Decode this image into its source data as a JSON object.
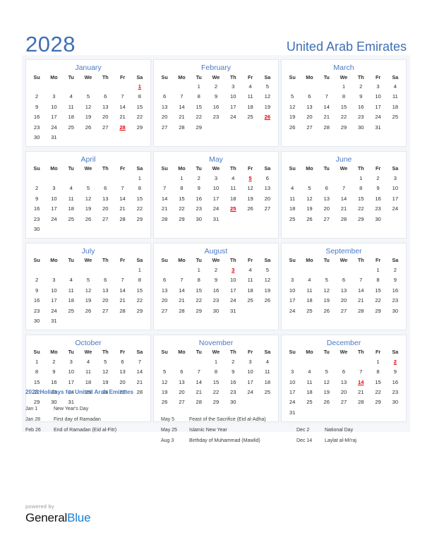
{
  "header": {
    "year": "2028",
    "country": "United Arab Emirates",
    "accent_color": "#3f6fb5"
  },
  "colors": {
    "month_name": "#4a79c4",
    "holiday_red": "#e4000c",
    "page_bg": "#ffffff",
    "grid_bg": "#f4f6f9"
  },
  "weekday_headers": [
    "Su",
    "Mo",
    "Tu",
    "We",
    "Th",
    "Fr",
    "Sa"
  ],
  "months": [
    {
      "name": "January",
      "weeks": [
        [
          "",
          "",
          "",
          "",
          "",
          "",
          "1"
        ],
        [
          "2",
          "3",
          "4",
          "5",
          "6",
          "7",
          "8"
        ],
        [
          "9",
          "10",
          "11",
          "12",
          "13",
          "14",
          "15"
        ],
        [
          "16",
          "17",
          "18",
          "19",
          "20",
          "21",
          "22"
        ],
        [
          "23",
          "24",
          "25",
          "26",
          "27",
          "28",
          "29"
        ],
        [
          "30",
          "31",
          "",
          "",
          "",
          "",
          ""
        ]
      ],
      "holidays": [
        "1",
        "28"
      ]
    },
    {
      "name": "February",
      "weeks": [
        [
          "",
          "",
          "1",
          "2",
          "3",
          "4",
          "5"
        ],
        [
          "6",
          "7",
          "8",
          "9",
          "10",
          "11",
          "12"
        ],
        [
          "13",
          "14",
          "15",
          "16",
          "17",
          "18",
          "19"
        ],
        [
          "20",
          "21",
          "22",
          "23",
          "24",
          "25",
          "26"
        ],
        [
          "27",
          "28",
          "29",
          "",
          "",
          "",
          ""
        ],
        [
          "",
          "",
          "",
          "",
          "",
          "",
          ""
        ]
      ],
      "holidays": [
        "26"
      ]
    },
    {
      "name": "March",
      "weeks": [
        [
          "",
          "",
          "",
          "1",
          "2",
          "3",
          "4"
        ],
        [
          "5",
          "6",
          "7",
          "8",
          "9",
          "10",
          "11"
        ],
        [
          "12",
          "13",
          "14",
          "15",
          "16",
          "17",
          "18"
        ],
        [
          "19",
          "20",
          "21",
          "22",
          "23",
          "24",
          "25"
        ],
        [
          "26",
          "27",
          "28",
          "29",
          "30",
          "31",
          ""
        ],
        [
          "",
          "",
          "",
          "",
          "",
          "",
          ""
        ]
      ],
      "holidays": []
    },
    {
      "name": "April",
      "weeks": [
        [
          "",
          "",
          "",
          "",
          "",
          "",
          "1"
        ],
        [
          "2",
          "3",
          "4",
          "5",
          "6",
          "7",
          "8"
        ],
        [
          "9",
          "10",
          "11",
          "12",
          "13",
          "14",
          "15"
        ],
        [
          "16",
          "17",
          "18",
          "19",
          "20",
          "21",
          "22"
        ],
        [
          "23",
          "24",
          "25",
          "26",
          "27",
          "28",
          "29"
        ],
        [
          "30",
          "",
          "",
          "",
          "",
          "",
          ""
        ]
      ],
      "holidays": []
    },
    {
      "name": "May",
      "weeks": [
        [
          "",
          "1",
          "2",
          "3",
          "4",
          "5",
          "6"
        ],
        [
          "7",
          "8",
          "9",
          "10",
          "11",
          "12",
          "13"
        ],
        [
          "14",
          "15",
          "16",
          "17",
          "18",
          "19",
          "20"
        ],
        [
          "21",
          "22",
          "23",
          "24",
          "25",
          "26",
          "27"
        ],
        [
          "28",
          "29",
          "30",
          "31",
          "",
          "",
          ""
        ],
        [
          "",
          "",
          "",
          "",
          "",
          "",
          ""
        ]
      ],
      "holidays": [
        "5",
        "25"
      ]
    },
    {
      "name": "June",
      "weeks": [
        [
          "",
          "",
          "",
          "",
          "1",
          "2",
          "3"
        ],
        [
          "4",
          "5",
          "6",
          "7",
          "8",
          "9",
          "10"
        ],
        [
          "11",
          "12",
          "13",
          "14",
          "15",
          "16",
          "17"
        ],
        [
          "18",
          "19",
          "20",
          "21",
          "22",
          "23",
          "24"
        ],
        [
          "25",
          "26",
          "27",
          "28",
          "29",
          "30",
          ""
        ],
        [
          "",
          "",
          "",
          "",
          "",
          "",
          ""
        ]
      ],
      "holidays": []
    },
    {
      "name": "July",
      "weeks": [
        [
          "",
          "",
          "",
          "",
          "",
          "",
          "1"
        ],
        [
          "2",
          "3",
          "4",
          "5",
          "6",
          "7",
          "8"
        ],
        [
          "9",
          "10",
          "11",
          "12",
          "13",
          "14",
          "15"
        ],
        [
          "16",
          "17",
          "18",
          "19",
          "20",
          "21",
          "22"
        ],
        [
          "23",
          "24",
          "25",
          "26",
          "27",
          "28",
          "29"
        ],
        [
          "30",
          "31",
          "",
          "",
          "",
          "",
          ""
        ]
      ],
      "holidays": []
    },
    {
      "name": "August",
      "weeks": [
        [
          "",
          "",
          "1",
          "2",
          "3",
          "4",
          "5"
        ],
        [
          "6",
          "7",
          "8",
          "9",
          "10",
          "11",
          "12"
        ],
        [
          "13",
          "14",
          "15",
          "16",
          "17",
          "18",
          "19"
        ],
        [
          "20",
          "21",
          "22",
          "23",
          "24",
          "25",
          "26"
        ],
        [
          "27",
          "28",
          "29",
          "30",
          "31",
          "",
          ""
        ],
        [
          "",
          "",
          "",
          "",
          "",
          "",
          ""
        ]
      ],
      "holidays": [
        "3"
      ]
    },
    {
      "name": "September",
      "weeks": [
        [
          "",
          "",
          "",
          "",
          "",
          "1",
          "2"
        ],
        [
          "3",
          "4",
          "5",
          "6",
          "7",
          "8",
          "9"
        ],
        [
          "10",
          "11",
          "12",
          "13",
          "14",
          "15",
          "16"
        ],
        [
          "17",
          "18",
          "19",
          "20",
          "21",
          "22",
          "23"
        ],
        [
          "24",
          "25",
          "26",
          "27",
          "28",
          "29",
          "30"
        ],
        [
          "",
          "",
          "",
          "",
          "",
          "",
          ""
        ]
      ],
      "holidays": []
    },
    {
      "name": "October",
      "weeks": [
        [
          "1",
          "2",
          "3",
          "4",
          "5",
          "6",
          "7"
        ],
        [
          "8",
          "9",
          "10",
          "11",
          "12",
          "13",
          "14"
        ],
        [
          "15",
          "16",
          "17",
          "18",
          "19",
          "20",
          "21"
        ],
        [
          "22",
          "23",
          "24",
          "25",
          "26",
          "27",
          "28"
        ],
        [
          "29",
          "30",
          "31",
          "",
          "",
          "",
          ""
        ],
        [
          "",
          "",
          "",
          "",
          "",
          "",
          ""
        ]
      ],
      "holidays": []
    },
    {
      "name": "November",
      "weeks": [
        [
          "",
          "",
          "",
          "1",
          "2",
          "3",
          "4"
        ],
        [
          "5",
          "6",
          "7",
          "8",
          "9",
          "10",
          "11"
        ],
        [
          "12",
          "13",
          "14",
          "15",
          "16",
          "17",
          "18"
        ],
        [
          "19",
          "20",
          "21",
          "22",
          "23",
          "24",
          "25"
        ],
        [
          "26",
          "27",
          "28",
          "29",
          "30",
          "",
          ""
        ],
        [
          "",
          "",
          "",
          "",
          "",
          "",
          ""
        ]
      ],
      "holidays": []
    },
    {
      "name": "December",
      "weeks": [
        [
          "",
          "",
          "",
          "",
          "",
          "1",
          "2"
        ],
        [
          "3",
          "4",
          "5",
          "6",
          "7",
          "8",
          "9"
        ],
        [
          "10",
          "11",
          "12",
          "13",
          "14",
          "15",
          "16"
        ],
        [
          "17",
          "18",
          "19",
          "20",
          "21",
          "22",
          "23"
        ],
        [
          "24",
          "25",
          "26",
          "27",
          "28",
          "29",
          "30"
        ],
        [
          "31",
          "",
          "",
          "",
          "",
          "",
          ""
        ]
      ],
      "holidays": [
        "2",
        "14"
      ]
    }
  ],
  "holidays_section": {
    "title": "2028 Holidays for United Arab Emirates",
    "columns": [
      [
        {
          "date": "Jan 1",
          "name": "New Year's Day"
        },
        {
          "date": "Jan 28",
          "name": "First day of Ramadan"
        },
        {
          "date": "Feb 26",
          "name": "End of Ramadan (Eid al-Fitr)"
        }
      ],
      [
        {
          "date": "",
          "name": ""
        },
        {
          "date": "May 5",
          "name": "Feast of the Sacrifice (Eid al-Adha)"
        },
        {
          "date": "May 25",
          "name": "Islamic New Year"
        },
        {
          "date": "Aug 3",
          "name": "Birthday of Muhammad (Mawlid)"
        }
      ],
      [
        {
          "date": "",
          "name": ""
        },
        {
          "date": "",
          "name": ""
        },
        {
          "date": "Dec 2",
          "name": "National Day"
        },
        {
          "date": "Dec 14",
          "name": "Laylat al-Mi'raj"
        }
      ]
    ]
  },
  "footer": {
    "powered_by": "powered by",
    "brand_first": "General",
    "brand_second": "Blue"
  }
}
